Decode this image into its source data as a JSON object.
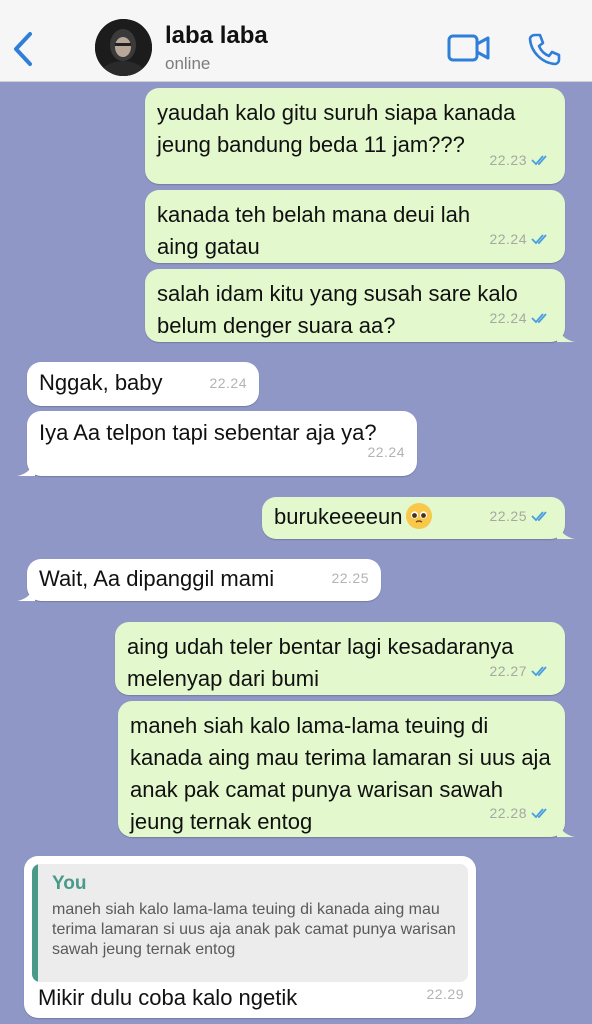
{
  "header": {
    "name": "laba laba",
    "status": "online"
  },
  "messages": [
    {
      "text": "yaudah kalo gitu suruh siapa kanada jeung bandung beda 11 jam???",
      "time": "22.23"
    },
    {
      "text": "kanada teh belah mana deui lah aing gatau",
      "time": "22.24"
    },
    {
      "text": "salah idam kitu yang susah sare kalo belum denger suara aa?",
      "time": "22.24"
    },
    {
      "text": "Nggak, baby",
      "time": "22.24"
    },
    {
      "text": "Iya Aa telpon tapi sebentar aja ya?",
      "time": "22.24"
    },
    {
      "text": "burukeeeeun",
      "time": "22.25"
    },
    {
      "text": "Wait, Aa dipanggil mami",
      "time": "22.25"
    },
    {
      "text": "aing udah teler bentar lagi kesadaranya melenyap dari bumi",
      "time": "22.27"
    },
    {
      "text": "maneh siah kalo lama-lama teuing di kanada aing mau terima lamaran si uus aja anak pak camat punya warisan sawah jeung ternak entog",
      "time": "22.28"
    },
    {
      "text": "Mikir dulu coba kalo ngetik",
      "time": "22.29",
      "quote_author": "You",
      "quote_text": "maneh siah kalo lama-lama teuing di kanada aing mau terima lamaran si uus aja anak pak camat punya warisan sawah jeung ternak entog"
    }
  ],
  "colors": {
    "wallpaper": "#8e97c5",
    "outgoing": "#e3f8cd",
    "incoming": "#ffffff",
    "accent": "#2f7fd8",
    "read_ticks": "#4a9fe0",
    "quote_author": "#4a9a8a"
  },
  "icons": {
    "back": "chevron-left-icon",
    "video": "video-camera-icon",
    "call": "phone-icon",
    "read": "double-check-icon",
    "emoji": "pleading-face-emoji"
  }
}
